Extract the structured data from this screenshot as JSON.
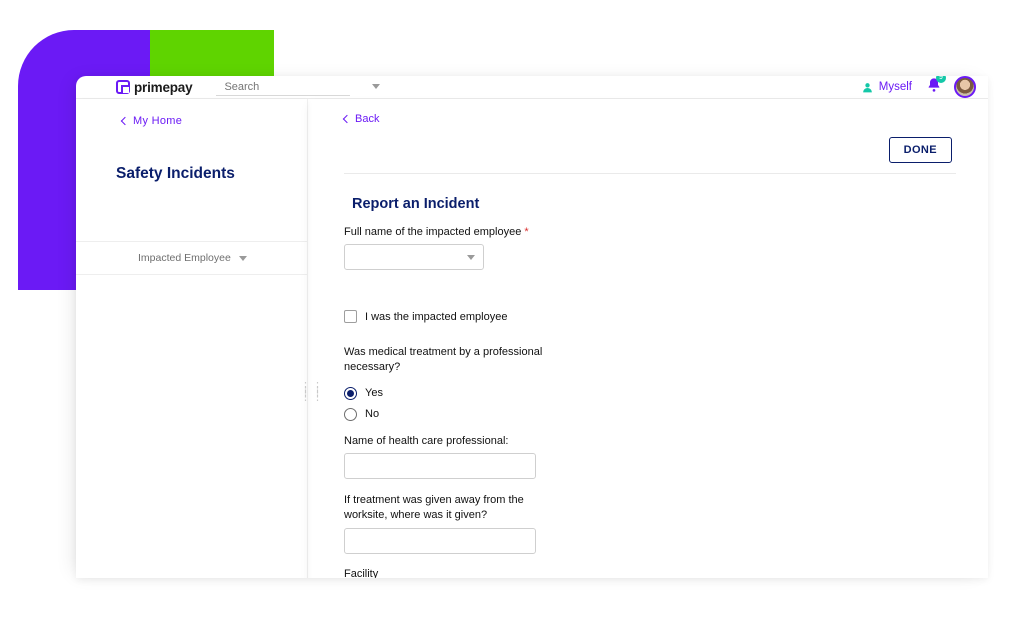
{
  "brand": {
    "name": "primepay"
  },
  "topbar": {
    "search_placeholder": "Search",
    "myself_label": "Myself",
    "notif_count": "9"
  },
  "sidebar": {
    "back_label": "My Home",
    "page_title": "Safety Incidents",
    "filter_label": "Impacted Employee"
  },
  "main": {
    "back_label": "Back",
    "done_label": "DONE",
    "heading": "Report an Incident",
    "fields": {
      "fullname_label": "Full name of the impacted employee",
      "self_checkbox_label": "I was the impacted employee",
      "medical_q": "Was medical treatment by a professional necessary?",
      "yes_label": "Yes",
      "no_label": "No",
      "healthpro_label": "Name of health care professional:",
      "offsite_label": "If treatment was given away from the worksite, where was it given?",
      "facility_label": "Facility"
    }
  }
}
